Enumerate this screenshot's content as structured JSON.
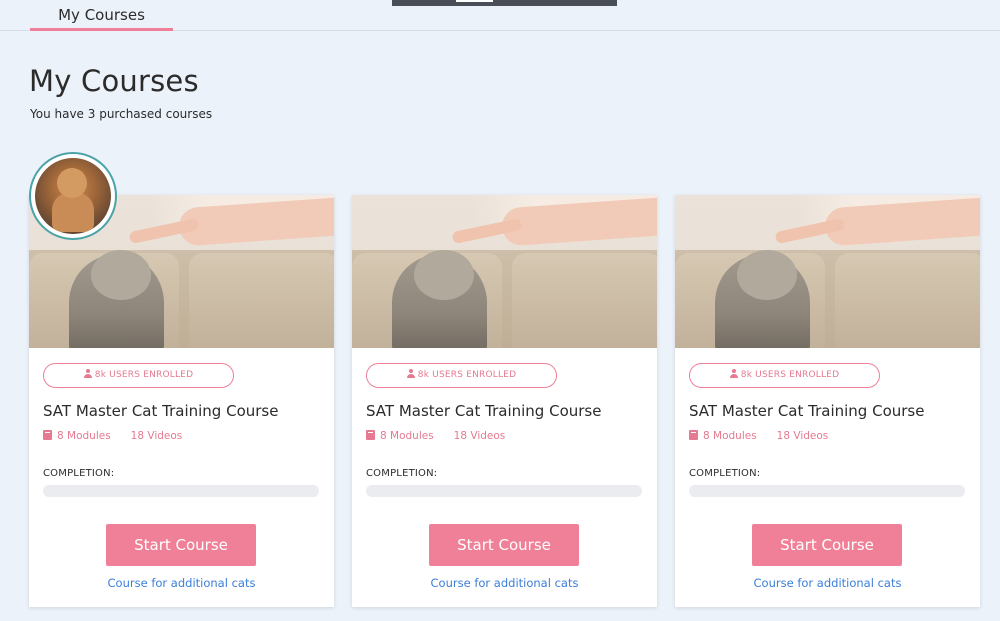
{
  "nav": {
    "tab_label": "My Courses"
  },
  "header": {
    "title": "My Courses",
    "subtitle": "You have 3 purchased courses"
  },
  "colors": {
    "accent": "#ef8097",
    "link": "#3b7fd9",
    "background": "#ecf2f9",
    "avatar_ring": "#4aa3a8"
  },
  "icons": {
    "badge_icon": "person-icon",
    "modules_icon": "book-icon"
  },
  "courses": [
    {
      "enrolled_badge": "8k USERS ENROLLED",
      "title": "SAT Master Cat Training Course",
      "modules": "8 Modules",
      "videos": "18 Videos",
      "completion_label": "COMPLETION:",
      "completion_fraction": 0,
      "button_label": "Start Course",
      "link_label": "Course for additional cats"
    },
    {
      "enrolled_badge": "8k USERS ENROLLED",
      "title": "SAT Master Cat Training Course",
      "modules": "8 Modules",
      "videos": "18 Videos",
      "completion_label": "COMPLETION:",
      "completion_fraction": 0,
      "button_label": "Start Course",
      "link_label": "Course for additional cats"
    },
    {
      "enrolled_badge": "8k USERS ENROLLED",
      "title": "SAT Master Cat Training Course",
      "modules": "8 Modules",
      "videos": "18 Videos",
      "completion_label": "COMPLETION:",
      "completion_fraction": 0,
      "button_label": "Start Course",
      "link_label": "Course for additional cats"
    }
  ]
}
